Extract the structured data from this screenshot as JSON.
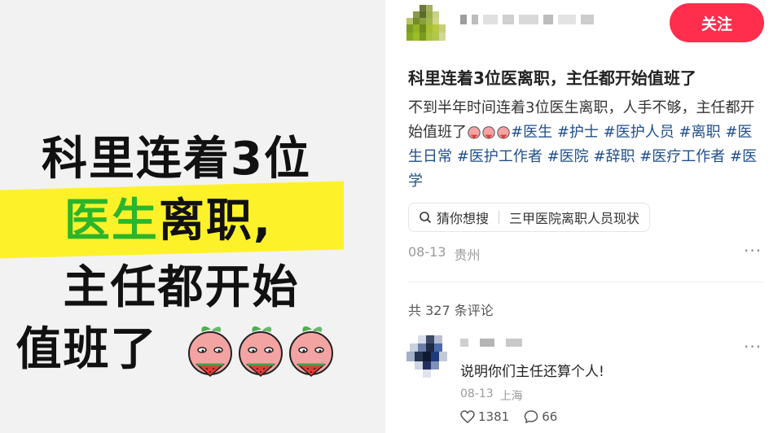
{
  "cover": {
    "line1": "科里连着3位",
    "line2_green": "医生",
    "line2_rest": "离职,",
    "line3": "主任都开始",
    "line4": "值班了",
    "emoji": "peach-face-eating-watermelon"
  },
  "header": {
    "follow_label": "关注"
  },
  "post": {
    "title": "科里连着3位医离职，主任都开始值班了",
    "body_text": "不到半年时间连着3位医生离职，人手不够，主任都开始值班了",
    "tags": [
      "#医生",
      "#护士",
      "#医护人员",
      "#离职",
      "#医生日常",
      "#医护工作者",
      "#医院",
      "#辞职",
      "#医疗工作者",
      "#医学"
    ],
    "search_prefix": "猜你想搜",
    "search_suggestion": "三甲医院离职人员现状",
    "date": "08-13",
    "location": "贵州"
  },
  "comments": {
    "count_label": "共 327 条评论",
    "items": [
      {
        "text": "说明你们主任还算个人!",
        "date": "08-13",
        "location": "上海",
        "likes": "1381",
        "replies": "66"
      }
    ]
  },
  "icons": {
    "more": "more-icon",
    "search": "search-icon",
    "like": "heart-icon",
    "reply": "comment-icon"
  },
  "colors": {
    "accent": "#ff2e4d",
    "tag": "#1f4e8c",
    "highlight": "#fdf22a",
    "green_text": "#2bb52b"
  }
}
